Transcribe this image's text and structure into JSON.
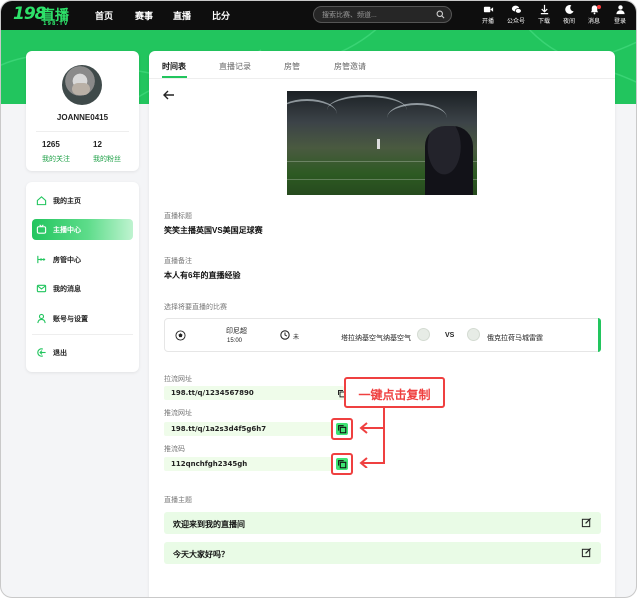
{
  "brand": {
    "logo_number": "198",
    "logo_text": "直播",
    "logo_sub": "198.TV"
  },
  "nav": {
    "links": [
      "首页",
      "赛事",
      "直播",
      "比分"
    ],
    "search_placeholder": "搜索比赛、频道...",
    "icons": [
      {
        "name": "broadcast-icon",
        "label": "开播"
      },
      {
        "name": "wechat-icon",
        "label": "公众号"
      },
      {
        "name": "download-icon",
        "label": "下载"
      },
      {
        "name": "night-mode-icon",
        "label": "夜间"
      },
      {
        "name": "bell-icon",
        "label": "消息"
      },
      {
        "name": "user-icon",
        "label": "登录"
      }
    ]
  },
  "profile": {
    "username": "JOANNE0415",
    "following_count": "1265",
    "following_label": "我的关注",
    "fans_count": "12",
    "fans_label": "我的粉丝"
  },
  "menu": {
    "items": [
      {
        "label": "我的主页",
        "icon": "home-icon"
      },
      {
        "label": "主播中心",
        "icon": "tv-icon",
        "active": true
      },
      {
        "label": "房管中心",
        "icon": "manager-icon"
      },
      {
        "label": "我的消息",
        "icon": "mail-icon"
      },
      {
        "label": "账号与设置",
        "icon": "user-settings-icon"
      }
    ],
    "logout": "退出"
  },
  "tabs": [
    "时间表",
    "直播记录",
    "房管",
    "房管邀请"
  ],
  "form": {
    "title_label": "直播标题",
    "title_value": "笑笑主播英国VS美国足球赛",
    "note_label": "直播备注",
    "note_value": "本人有6年的直播经验",
    "match_label": "选择将要直播的比赛",
    "match": {
      "league": "印尼超",
      "time": "15:00",
      "status": "未",
      "home_team": "塔拉纳基空气纳基空气",
      "vs": "VS",
      "away_team": "俄克拉荷马城雷霆"
    },
    "pull_url_label": "拉流网址",
    "pull_url": "198.tt/q/1234567890",
    "push_url_label": "推流网址",
    "push_url": "198.tt/q/1a2s3d4f5g6h7",
    "push_code_label": "推流码",
    "push_code": "112qnchfgh2345gh",
    "topic_label": "直播主题",
    "topics": [
      "欢迎来到我的直播间",
      "今天大家好吗？"
    ]
  },
  "callout": "一键点击复制",
  "colors": {
    "accent": "#22c55e",
    "highlight": "#ef4040"
  }
}
